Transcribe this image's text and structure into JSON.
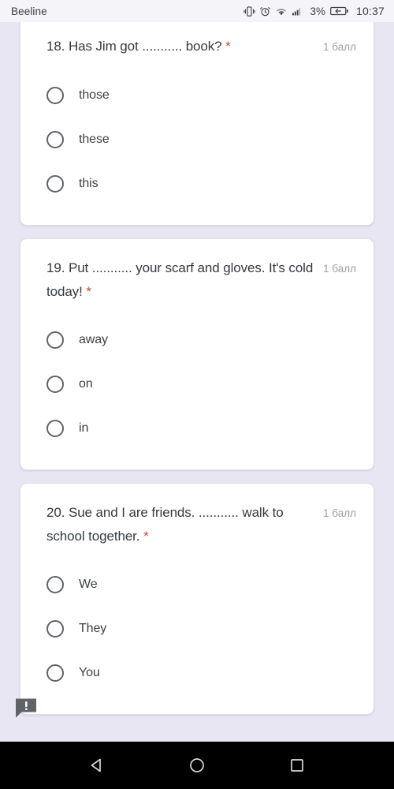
{
  "status_bar": {
    "carrier": "Beeline",
    "battery_percent": "3%",
    "clock": "10:37",
    "icons": [
      "vibrate-icon",
      "alarm-icon",
      "wifi-icon",
      "signal-icon",
      "battery-charging-icon"
    ]
  },
  "form": {
    "questions": [
      {
        "text": "18. Has Jim got ........... book?",
        "required_marker": "*",
        "points": "1 балл",
        "options": [
          {
            "label": "those",
            "selected": false
          },
          {
            "label": "these",
            "selected": false
          },
          {
            "label": "this",
            "selected": false
          }
        ]
      },
      {
        "text": "19. Put ........... your scarf and gloves. It's cold today!",
        "required_marker": "*",
        "points": "1 балл",
        "options": [
          {
            "label": "away",
            "selected": false
          },
          {
            "label": "on",
            "selected": false
          },
          {
            "label": "in",
            "selected": false
          }
        ]
      },
      {
        "text": "20. Sue and I are friends. ........... walk to school together.",
        "required_marker": "*",
        "points": "1 балл",
        "options": [
          {
            "label": "We",
            "selected": false
          },
          {
            "label": "They",
            "selected": false
          },
          {
            "label": "You",
            "selected": false
          }
        ]
      }
    ]
  },
  "feedback_badge": {
    "icon": "comment-alert-icon"
  },
  "nav_bar": {
    "back": "back-triangle-icon",
    "home": "home-circle-icon",
    "recents": "recents-square-icon"
  },
  "colors": {
    "background": "#e9e6f3",
    "card": "#ffffff",
    "required_asterisk": "#c5483c",
    "points_text": "#9aa0a6",
    "question_text": "#343a40",
    "radio_border": "#5f6368",
    "navbar": "#000000"
  }
}
